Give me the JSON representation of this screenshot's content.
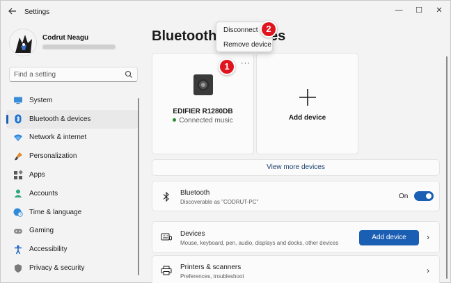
{
  "window": {
    "title": "Settings",
    "controls": {
      "minimize": "—",
      "maximize": "☐",
      "close": "✕"
    }
  },
  "profile": {
    "name": "Codrut Neagu"
  },
  "search": {
    "placeholder": "Find a setting"
  },
  "nav": {
    "items": [
      {
        "label": "System",
        "icon": "monitor-icon"
      },
      {
        "label": "Bluetooth & devices",
        "icon": "bluetooth-icon"
      },
      {
        "label": "Network & internet",
        "icon": "wifi-icon"
      },
      {
        "label": "Personalization",
        "icon": "paintbrush-icon"
      },
      {
        "label": "Apps",
        "icon": "apps-icon"
      },
      {
        "label": "Accounts",
        "icon": "person-icon"
      },
      {
        "label": "Time & language",
        "icon": "globe-clock-icon"
      },
      {
        "label": "Gaming",
        "icon": "gamepad-icon"
      },
      {
        "label": "Accessibility",
        "icon": "accessibility-icon"
      },
      {
        "label": "Privacy & security",
        "icon": "shield-icon"
      }
    ],
    "active_index": 1
  },
  "main": {
    "title": "Bluetooth & devices",
    "device_card": {
      "name": "EDIFIER R1280DB",
      "status": "Connected music",
      "more_label": "···"
    },
    "add_card": {
      "label": "Add device",
      "plus": "+"
    },
    "view_more": "View more devices",
    "bluetooth_row": {
      "title": "Bluetooth",
      "subtitle": "Discoverable as \"CODRUT-PC\"",
      "toggle_label": "On",
      "toggle_on": true
    },
    "devices_row": {
      "title": "Devices",
      "subtitle": "Mouse, keyboard, pen, audio, displays and docks, other devices",
      "button_label": "Add device",
      "chevron": "›"
    },
    "printers_row": {
      "title": "Printers & scanners",
      "subtitle": "Preferences, troubleshoot",
      "chevron": "›"
    }
  },
  "context_menu": {
    "items": [
      "Disconnect",
      "Remove device"
    ]
  },
  "callouts": [
    "1",
    "2"
  ],
  "colors": {
    "accent": "#1a5fb4",
    "callout": "#e0141e",
    "status_connected": "#2e8b2e"
  }
}
